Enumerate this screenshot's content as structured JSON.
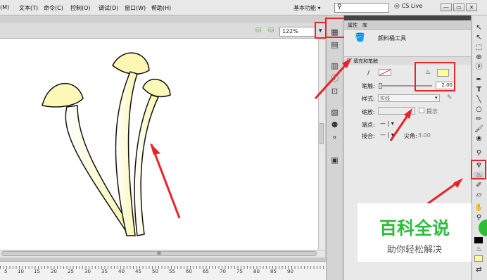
{
  "menu": [
    "(M)",
    "文本(T)",
    "命令(C)",
    "控制(O)",
    "调试(D)",
    "窗口(W)",
    "帮助(H)"
  ],
  "workspace": "基本功能",
  "cslive": "CS Live",
  "window_buttons": [
    "—",
    "▭",
    "✕"
  ],
  "zoom": "122%",
  "ruler_numbers": [
    "5",
    "10",
    "15",
    "20",
    "25",
    "30",
    "35",
    "40",
    "45",
    "50",
    "55",
    "60",
    "65",
    "70",
    "75",
    "80",
    "85",
    "90"
  ],
  "hscroll_grip": "III",
  "panel": {
    "tab_properties": "属性",
    "tab_library": "库",
    "tool_name": "颜料桶工具",
    "section": "填充和笔触",
    "stroke_label": "笔触:",
    "stroke_value": "2.00",
    "style_label": "样式:",
    "style_value": "实线",
    "scale_label": "缩放:",
    "hint_label": "提示",
    "cap_label": "端点:",
    "join_label": "接合:",
    "miter_label": "尖角:",
    "miter_value": "3.00"
  },
  "watermark": {
    "title": "百科全说",
    "subtitle": "助你轻松解决"
  },
  "colors": {
    "fill": "#ffff99",
    "highlight": "#e8242a",
    "watermark_green": "#2ebd3a"
  }
}
